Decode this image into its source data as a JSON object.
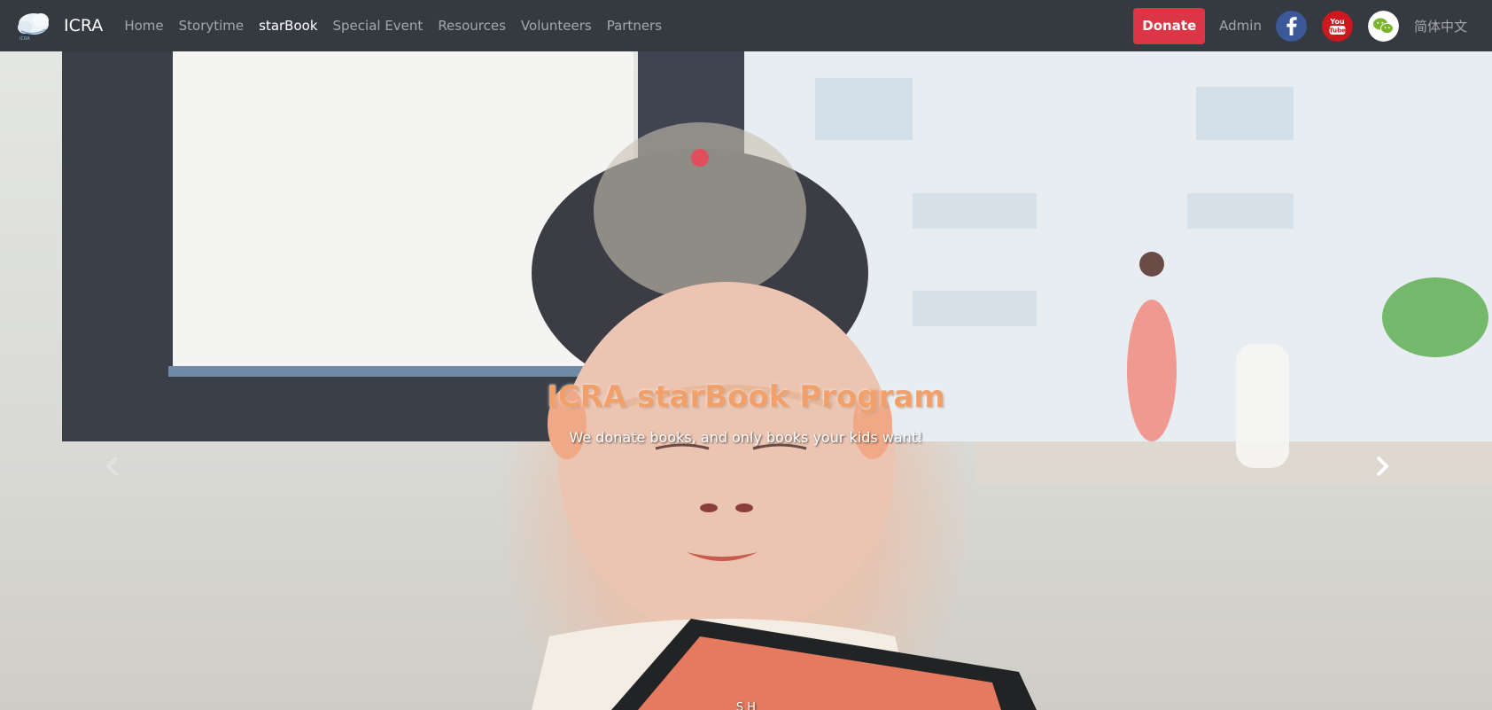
{
  "navbar": {
    "brand": "ICRA",
    "links": [
      "Home",
      "Storytime",
      "starBook",
      "Special Event",
      "Resources",
      "Volunteers",
      "Partners"
    ],
    "active_link": "starBook",
    "donate_label": "Donate",
    "admin_label": "Admin",
    "language_label": "简体中文",
    "social_icons": [
      "facebook-icon",
      "youtube-icon",
      "wechat-icon"
    ]
  },
  "hero": {
    "title": "ICRA starBook Program",
    "subtitle": "We donate books, and only books your kids want!",
    "partial_bottom_text": "S    H  "
  },
  "colors": {
    "navbar_bg": "#343a40",
    "donate_bg": "#dc3545",
    "title_color": "#f2a06a",
    "facebook_blue": "#3b5998",
    "youtube_red": "#cc181e",
    "wechat_green": "#7bb32e"
  }
}
